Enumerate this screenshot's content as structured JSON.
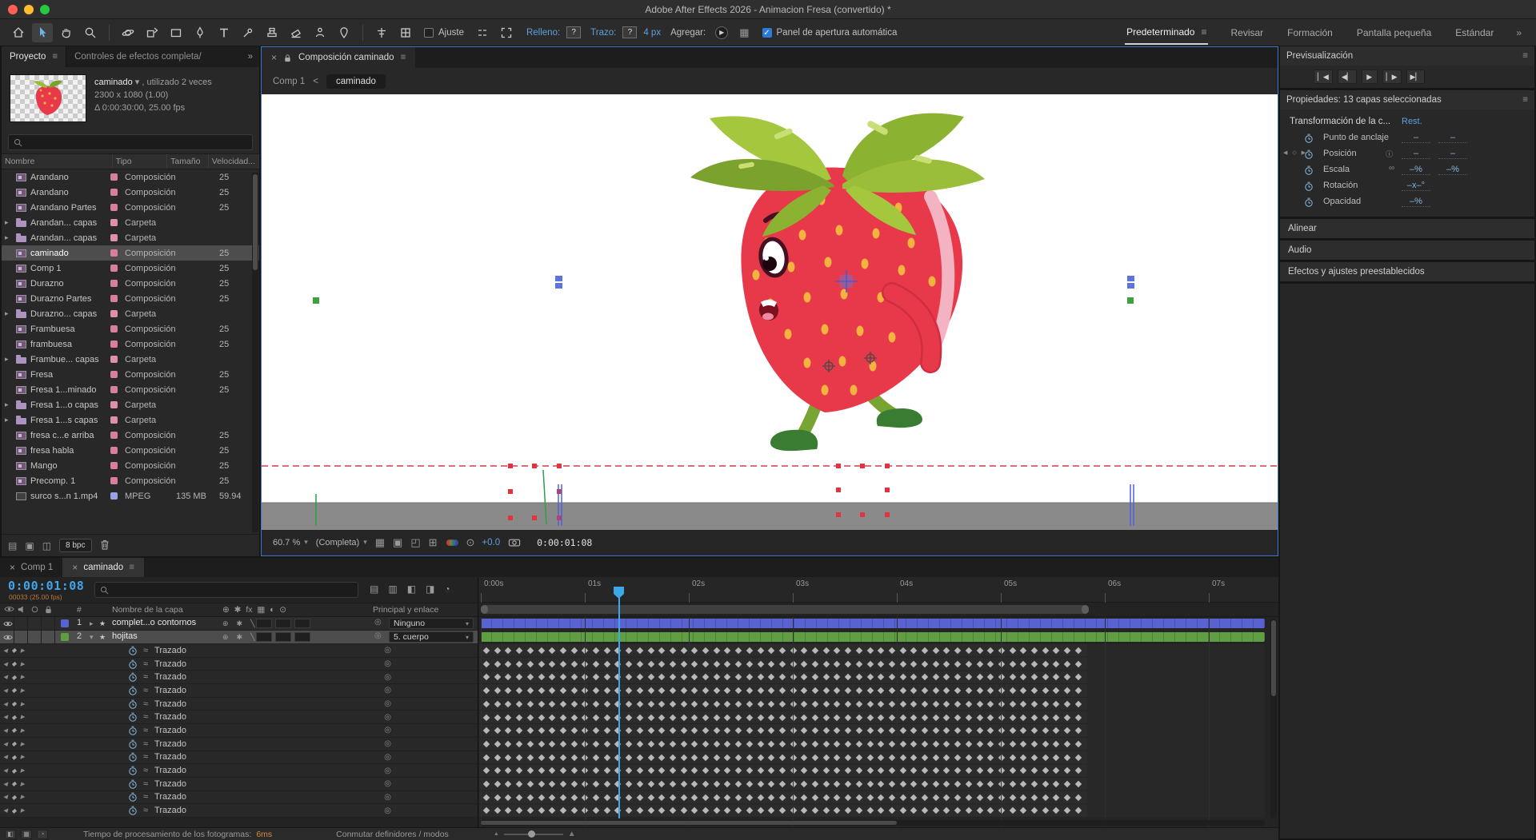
{
  "titlebar": {
    "title": "Adobe After Effects 2026 - Animacion Fresa (convertido) *"
  },
  "toolbar": {
    "snap_label": "Ajuste",
    "fill_label": "Relleno:",
    "fill_value": "?",
    "stroke_label": "Trazo:",
    "stroke_value": "?",
    "stroke_width": "4 px",
    "add_label": "Agregar:",
    "auto_open_label": "Panel de apertura automática",
    "workspaces": [
      {
        "label": "Predeterminado"
      },
      {
        "label": "Revisar"
      },
      {
        "label": "Formación"
      },
      {
        "label": "Pantalla pequeña"
      },
      {
        "label": "Estándar"
      }
    ],
    "overflow": "»"
  },
  "project": {
    "tab": "Proyecto",
    "tab2": "Controles de efectos completa/Fre",
    "overflow": "»",
    "info_name": "caminado",
    "info_usage": ", utilizado 2 veces",
    "info_dims": "2300 x 1080 (1.00)",
    "info_duration": "Δ 0:00:30:00, 25.00 fps",
    "columns": {
      "name": "Nombre",
      "type": "Tipo",
      "size": "Tamaño",
      "speed": "Velocidad..."
    },
    "rows": [
      {
        "name": "Arandano",
        "kind": "comp",
        "type": "Composición",
        "size": "",
        "speed": "25"
      },
      {
        "name": "Arandano",
        "kind": "comp",
        "type": "Composición",
        "size": "",
        "speed": "25"
      },
      {
        "name": "Arandano Partes",
        "kind": "comp",
        "type": "Composición",
        "size": "",
        "speed": "25"
      },
      {
        "name": "Arandan... capas",
        "kind": "folder",
        "type": "Carpeta",
        "size": "",
        "speed": ""
      },
      {
        "name": "Arandan... capas",
        "kind": "folder",
        "type": "Carpeta",
        "size": "",
        "speed": ""
      },
      {
        "name": "caminado",
        "kind": "comp",
        "type": "Composición",
        "size": "",
        "speed": "25",
        "selected": true
      },
      {
        "name": "Comp 1",
        "kind": "comp",
        "type": "Composición",
        "size": "",
        "speed": "25"
      },
      {
        "name": "Durazno",
        "kind": "comp",
        "type": "Composición",
        "size": "",
        "speed": "25"
      },
      {
        "name": "Durazno Partes",
        "kind": "comp",
        "type": "Composición",
        "size": "",
        "speed": "25"
      },
      {
        "name": "Durazno... capas",
        "kind": "folder",
        "type": "Carpeta",
        "size": "",
        "speed": ""
      },
      {
        "name": "Frambuesa",
        "kind": "comp",
        "type": "Composición",
        "size": "",
        "speed": "25"
      },
      {
        "name": "frambuesa",
        "kind": "comp",
        "type": "Composición",
        "size": "",
        "speed": "25"
      },
      {
        "name": "Frambue... capas",
        "kind": "folder",
        "type": "Carpeta",
        "size": "",
        "speed": ""
      },
      {
        "name": "Fresa",
        "kind": "comp",
        "type": "Composición",
        "size": "",
        "speed": "25"
      },
      {
        "name": "Fresa 1...minado",
        "kind": "comp",
        "type": "Composición",
        "size": "",
        "speed": "25"
      },
      {
        "name": "Fresa 1...o capas",
        "kind": "folder",
        "type": "Carpeta",
        "size": "",
        "speed": ""
      },
      {
        "name": "Fresa 1...s capas",
        "kind": "folder",
        "type": "Carpeta",
        "size": "",
        "speed": ""
      },
      {
        "name": "fresa c...e arriba",
        "kind": "comp",
        "type": "Composición",
        "size": "",
        "speed": "25"
      },
      {
        "name": "fresa habla",
        "kind": "comp",
        "type": "Composición",
        "size": "",
        "speed": "25"
      },
      {
        "name": "Mango",
        "kind": "comp",
        "type": "Composición",
        "size": "",
        "speed": "25"
      },
      {
        "name": "Precomp. 1",
        "kind": "comp",
        "type": "Composición",
        "size": "",
        "speed": "25"
      },
      {
        "name": "surco s...n 1.mp4",
        "kind": "footage",
        "type": "MPEG",
        "size": "135 MB",
        "speed": "59.94"
      }
    ],
    "bpc": "8 bpc"
  },
  "viewer": {
    "tab_title": "Composición caminado",
    "breadcrumb_parent": "Comp 1",
    "breadcrumb_current": "caminado",
    "zoom": "60.7 %",
    "resolution": "(Completa)",
    "exposure": "+0.0",
    "timecode": "0:00:01:08"
  },
  "preview": {
    "title": "Previsualización"
  },
  "properties": {
    "title": "Propiedades: 13 capas seleccionadas",
    "transform_title": "Transformación de la c...",
    "reset_label": "Rest.",
    "rows": [
      {
        "label": "Punto de anclaje",
        "values": [
          "–",
          "–"
        ]
      },
      {
        "label": "Posición",
        "values": [
          "–",
          "–"
        ]
      },
      {
        "label": "Escala",
        "values": [
          "–%",
          "–%"
        ]
      },
      {
        "label": "Rotación",
        "values": [
          "–x–°"
        ]
      },
      {
        "label": "Opacidad",
        "values": [
          "–%"
        ]
      }
    ],
    "sections": [
      "Alinear",
      "Audio",
      "Efectos y ajustes preestablecidos"
    ]
  },
  "timeline": {
    "tabs": [
      {
        "label": "Comp 1"
      },
      {
        "label": "caminado"
      }
    ],
    "timecode": "0:00:01:08",
    "frame_info": "00033 (25.00 fps)",
    "headers": {
      "number": "#",
      "layer_name": "Nombre de la capa",
      "parent": "Principal y enlace"
    },
    "layers": [
      {
        "num": "1",
        "name": "complet...o contornos",
        "parent": "Ninguno",
        "color": "#5863cf"
      },
      {
        "num": "2",
        "name": "hojitas",
        "parent": "5. cuerpo",
        "color": "#5f9e43",
        "selected": true
      }
    ],
    "property_label": "Trazado",
    "property_count": 13,
    "ruler": [
      "0:00s",
      "01s",
      "02s",
      "03s",
      "04s",
      "05s",
      "06s",
      "07s"
    ],
    "keyframes": {
      "columns": 55
    },
    "status_label": "Tiempo de procesamiento de los fotogramas:",
    "status_value": "6ms",
    "toggle_label": "Conmutar definidores / modos"
  },
  "icons": {
    "menu": "≡",
    "close": "×",
    "chevron_down": "▾",
    "twirl_open": "▾",
    "twirl_closed": "▸",
    "breadcrumb_back": "<",
    "prev": "◀",
    "next": "▶",
    "keyframe": "◆",
    "keyframe_hollow": "◇",
    "pickwhip": "◎",
    "graph_toggle": "≈",
    "info": "ⓘ",
    "link": "∞",
    "overflow": "»",
    "grid": "▦",
    "exposure": "⊙",
    "check": "✓",
    "layer_icon": "★",
    "transport": [
      "▏◀",
      "◀▏",
      "▶",
      "▏▶",
      "▶▏"
    ],
    "switch_columns": [
      "⊕",
      "✱",
      "fx",
      "▦",
      "◐",
      "⊙"
    ],
    "layer_switches": [
      "⊕",
      "✱",
      "╲"
    ],
    "viewer_toggles": [
      "▦",
      "▣",
      "◰",
      "⊞"
    ],
    "status_toggles": [
      "◧",
      "▦",
      "◔"
    ],
    "mountain": "▲"
  }
}
